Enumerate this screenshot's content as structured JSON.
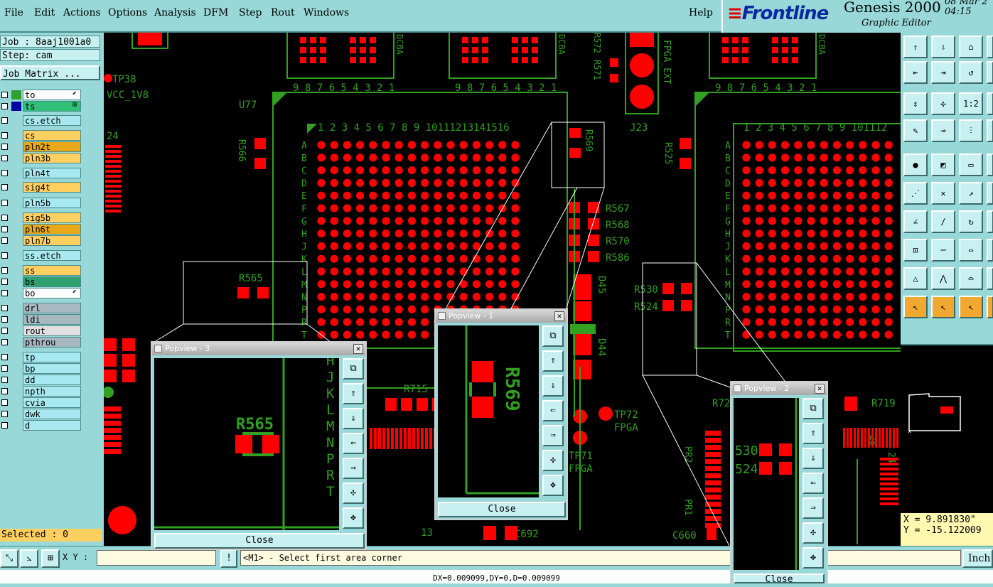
{
  "menu": {
    "items": [
      "File",
      "Edit",
      "Actions",
      "Options",
      "Analysis",
      "DFM",
      "Step",
      "Rout",
      "Windows"
    ],
    "help": "Help"
  },
  "brand": {
    "logo": "Frontline",
    "product": "Genesis 2000",
    "subtitle": "Graphic Editor",
    "date": "08 Mar 2",
    "time": "04:15 "
  },
  "job": {
    "job": "Job : 8aaj1001a0",
    "step": "Step: cam",
    "matrix_button": "Job Matrix ..."
  },
  "layers": [
    {
      "name": "to",
      "bg": "#ffffff",
      "swatch": "#30a030",
      "suffix": "⬋"
    },
    {
      "name": "ts",
      "bg": "#30c078",
      "swatch": "#0000a0",
      "suffix": "⊞"
    },
    {
      "name": "cs.etch",
      "bg": "#a8e8f0",
      "swatch": ""
    },
    {
      "name": "cs",
      "bg": "#ffd060",
      "swatch": ""
    },
    {
      "name": "pln2t",
      "bg": "#e8a818",
      "swatch": ""
    },
    {
      "name": "pln3b",
      "bg": "#ffd060",
      "swatch": ""
    },
    {
      "name": "pln4t",
      "bg": "#a8e8f0",
      "swatch": ""
    },
    {
      "name": "sig4t",
      "bg": "#ffd060",
      "swatch": ""
    },
    {
      "name": "pln5b",
      "bg": "#a8e8f0",
      "swatch": ""
    },
    {
      "name": "sig5b",
      "bg": "#ffd060",
      "swatch": ""
    },
    {
      "name": "pln6t",
      "bg": "#e8a818",
      "swatch": ""
    },
    {
      "name": "pln7b",
      "bg": "#ffd060",
      "swatch": ""
    },
    {
      "name": "ss.etch",
      "bg": "#a8e8f0",
      "swatch": ""
    },
    {
      "name": "ss",
      "bg": "#ffd060",
      "swatch": ""
    },
    {
      "name": "bs",
      "bg": "#30a070",
      "swatch": ""
    },
    {
      "name": "bo",
      "bg": "#ffffff",
      "swatch": "",
      "suffix": "⬋"
    },
    {
      "name": "drl",
      "bg": "#a8b8c0",
      "swatch": ""
    },
    {
      "name": "ldi",
      "bg": "#a8b8c0",
      "swatch": ""
    },
    {
      "name": "rout",
      "bg": "#e0e0e0",
      "swatch": ""
    },
    {
      "name": "pthrou",
      "bg": "#a8b8c0",
      "swatch": ""
    },
    {
      "name": "tp",
      "bg": "#a8e8f0",
      "swatch": ""
    },
    {
      "name": "bp",
      "bg": "#a8e8f0",
      "swatch": ""
    },
    {
      "name": "dd",
      "bg": "#a8e8f0",
      "swatch": ""
    },
    {
      "name": "npth",
      "bg": "#a8e8f0",
      "swatch": ""
    },
    {
      "name": "cvia",
      "bg": "#a8e8f0",
      "swatch": ""
    },
    {
      "name": "dwk",
      "bg": "#a8e8f0",
      "swatch": ""
    },
    {
      "name": "d",
      "bg": "#a8e8f0",
      "swatch": ""
    }
  ],
  "selected": "Selected : 0",
  "coords": {
    "x": "X =  9.891830\"",
    "y": "Y = -15.122009"
  },
  "bottom": {
    "xy_label": "X Y :",
    "xy_value": "",
    "prompt": "<M1> - Select first area corner",
    "units": "Inch"
  },
  "status": "DX=0.009099,DY=0,D=0.009099",
  "popups": {
    "p1": {
      "title": "Popview - 1",
      "close": "Close",
      "label": "R569"
    },
    "p2": {
      "title": "Popview - 2",
      "close": "Close",
      "labels": [
        "530",
        "524"
      ]
    },
    "p3": {
      "title": "Popview - 3",
      "close": "Close",
      "label": "R565",
      "letters": [
        "H",
        "J",
        "K",
        "L",
        "M",
        "N",
        "P",
        "R",
        "T"
      ]
    }
  },
  "board": {
    "refs": [
      "TP38",
      "VCC_1V8",
      "U77",
      "R566",
      "R569",
      "R567",
      "R568",
      "R570",
      "R586",
      "R565",
      "D45",
      "D44",
      "R715",
      "TP72",
      "FPGA",
      "TP71",
      "FPGA",
      "C692",
      "R530",
      "R524",
      "R525",
      "J23",
      "FPGA_EXT",
      "R572",
      "R571",
      "R719",
      "PR2",
      "PR1",
      "C660",
      "R72",
      "24",
      "25",
      "24",
      "13"
    ],
    "col_numbers": "1 2 3 4 5 6 7 8 9 10111213141516",
    "col_numbers_r": "1 2 3 4 5 6 7 8 9 101112",
    "row_letters": [
      "A",
      "B",
      "C",
      "D",
      "E",
      "F",
      "G",
      "H",
      "J",
      "K",
      "L",
      "M",
      "N",
      "P",
      "R",
      "T"
    ],
    "conn_digits": "9 8 7 6 5 4 3 2 1",
    "conn_letters": "DCBA"
  },
  "colors": {
    "copper": "#ff0000",
    "silk": "#32a020",
    "outline": "#ffffff",
    "panel": "#98d8d8"
  }
}
